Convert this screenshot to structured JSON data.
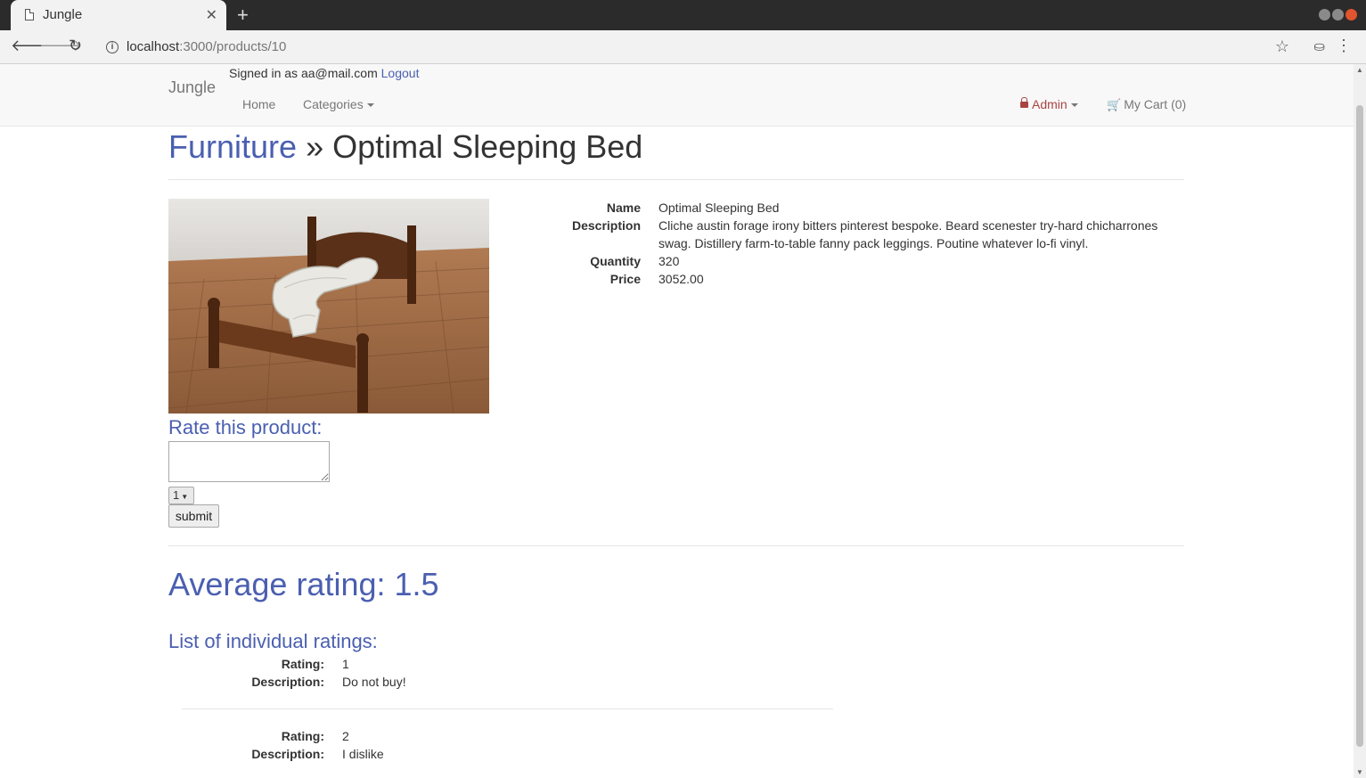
{
  "browser": {
    "tab_title": "Jungle",
    "url_host": "localhost",
    "url_path": ":3000/products/10"
  },
  "navbar": {
    "brand": "Jungle",
    "signed_in_text": "Signed in as aa@mail.com",
    "logout_label": "Logout",
    "home_label": "Home",
    "categories_label": "Categories",
    "admin_label": "Admin",
    "cart_label": "My Cart (0)"
  },
  "product": {
    "category": "Furniture",
    "separator": "»",
    "title": "Optimal Sleeping Bed",
    "details": {
      "name_label": "Name",
      "name": "Optimal Sleeping Bed",
      "description_label": "Description",
      "description": "Cliche austin forage irony bitters pinterest bespoke. Beard scenester try-hard chicharrones swag. Distillery farm-to-table fanny pack leggings. Poutine whatever lo-fi vinyl.",
      "quantity_label": "Quantity",
      "quantity": "320",
      "price_label": "Price",
      "price": "3052.00"
    }
  },
  "rate_form": {
    "title": "Rate this product:",
    "text_value": "",
    "selected_rating": "1",
    "submit_label": "submit"
  },
  "ratings": {
    "average_text": "Average rating: 1.5",
    "list_title": "List of individual ratings:",
    "rating_label": "Rating:",
    "description_label": "Description:",
    "items": [
      {
        "rating": "1",
        "description": "Do not buy!"
      },
      {
        "rating": "2",
        "description": "I dislike"
      }
    ]
  }
}
